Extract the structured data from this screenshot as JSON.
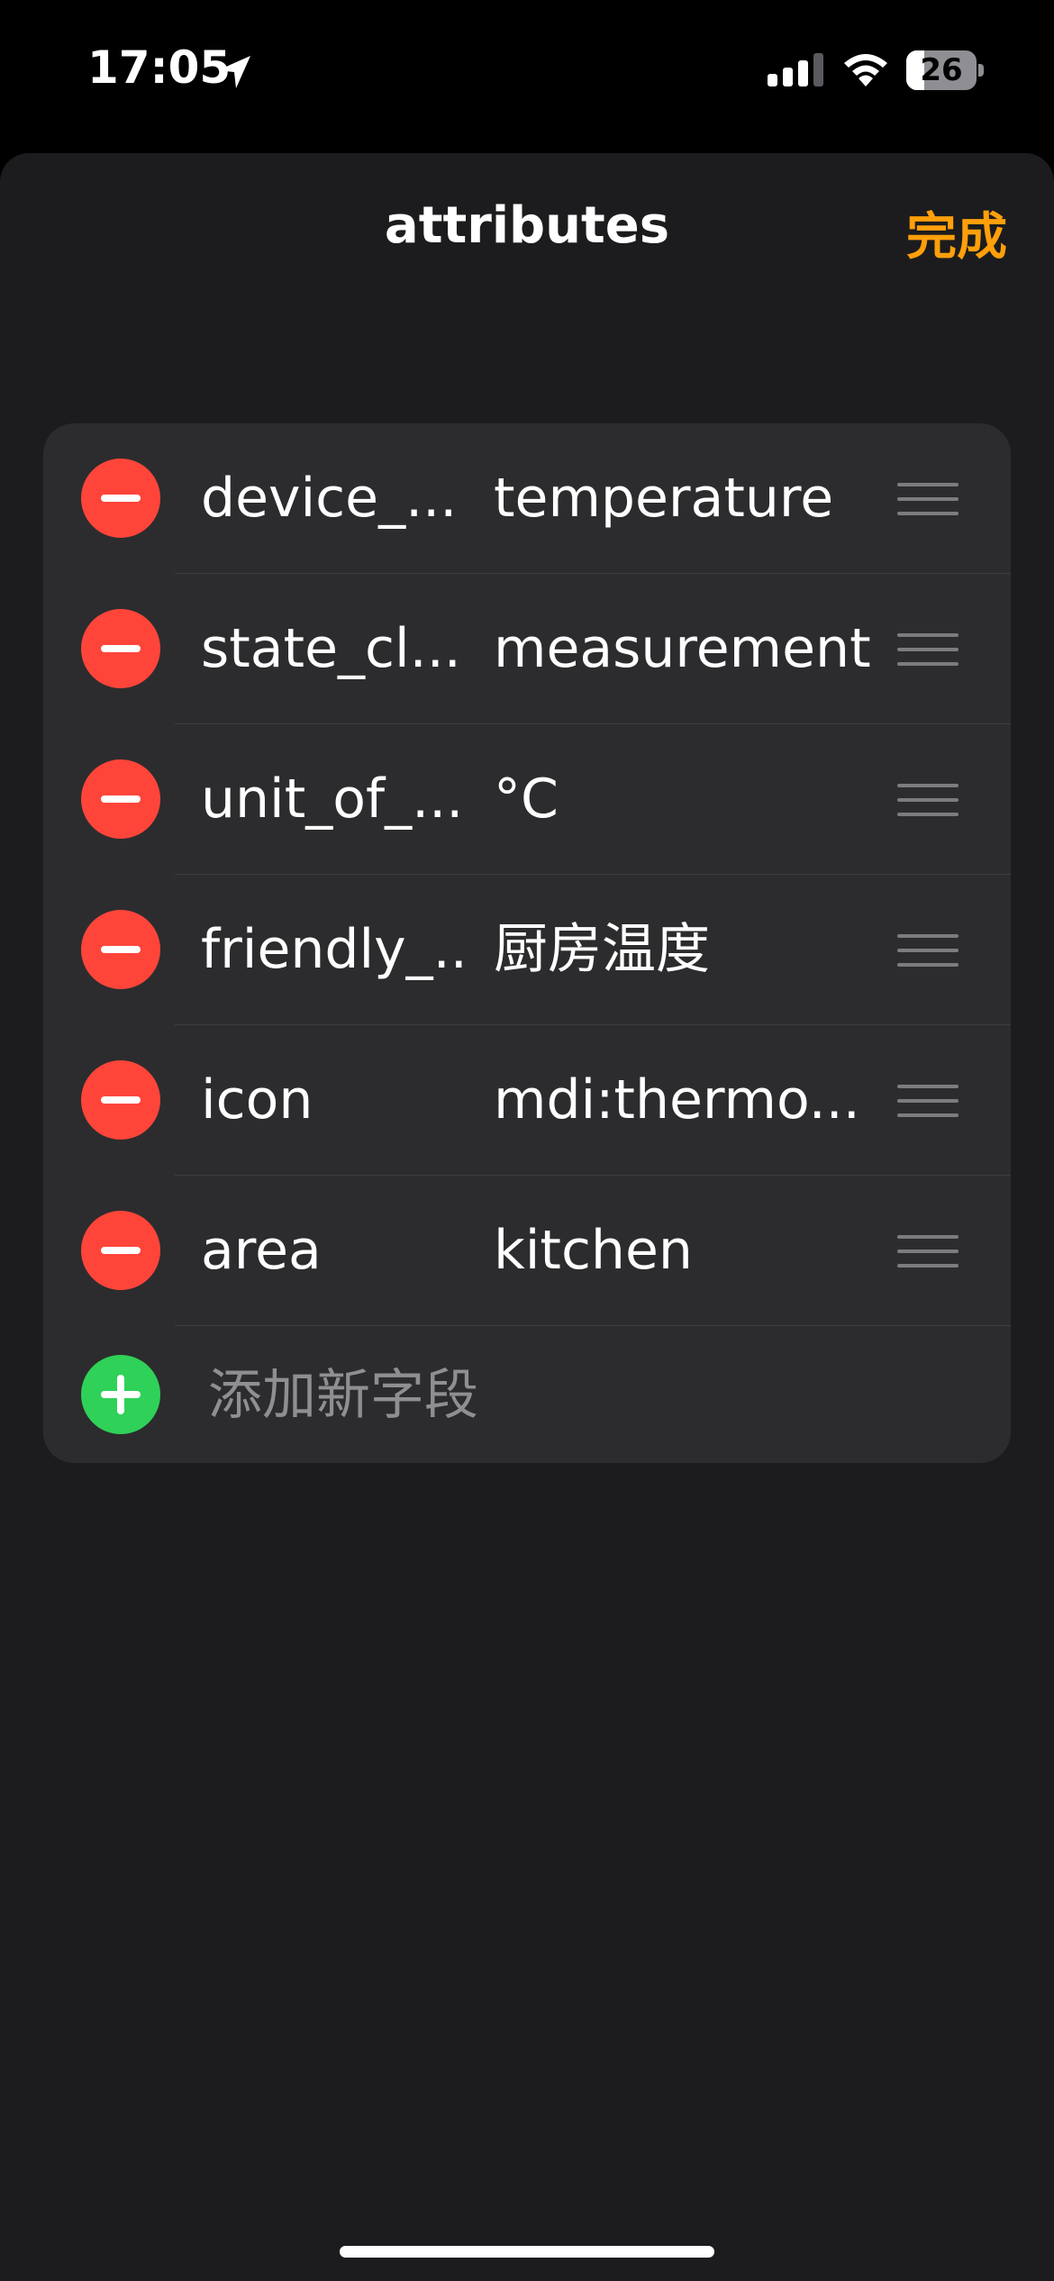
{
  "status_bar": {
    "time": "17:05",
    "battery": "26",
    "battery_level": 0.26
  },
  "nav": {
    "title": "attributes",
    "done_label": "完成"
  },
  "rows": [
    {
      "key": "device_...",
      "value": "temperature"
    },
    {
      "key": "state_cl...",
      "value": "measurement"
    },
    {
      "key": "unit_of_...",
      "value": "°C"
    },
    {
      "key": "friendly_...",
      "value": "厨房温度"
    },
    {
      "key": "icon",
      "value": "mdi:thermo..."
    },
    {
      "key": "area",
      "value": "kitchen"
    }
  ],
  "add_row": {
    "label": "添加新字段"
  },
  "colors": {
    "accent": "#ff9f0a",
    "delete": "#ff453a",
    "add": "#30d158",
    "background": "#1c1c1e",
    "card": "#2c2c2e"
  }
}
